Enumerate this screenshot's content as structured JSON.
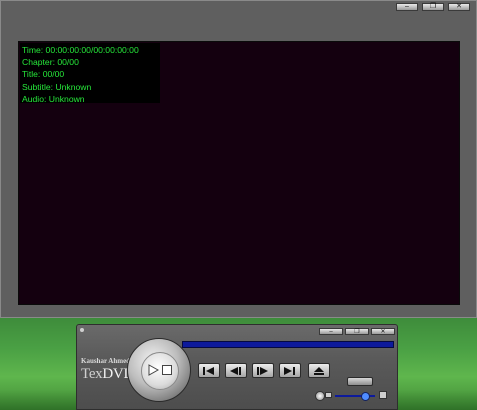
{
  "osd": {
    "time": "Time: 00:00:00:00/00:00:00:00",
    "chapter": "Chapter: 00/00",
    "title": "Title: 00/00",
    "subtitle": "Subtitle: Unknown",
    "audio": "Audio: Unknown"
  },
  "window_controls": {
    "minimize": "–",
    "restore": "❐",
    "close": "✕"
  },
  "player": {
    "author": "Kaushar Ahmed",
    "logo_tex": "Tex",
    "logo_dvd": "DVD"
  },
  "transport": {
    "buttons": [
      "previous-chapter",
      "step-back",
      "step-forward",
      "next-chapter",
      "eject"
    ]
  },
  "colors": {
    "osd_text": "#26e83a",
    "video_bg": "#14000f",
    "progress": "#0d1a9c"
  }
}
